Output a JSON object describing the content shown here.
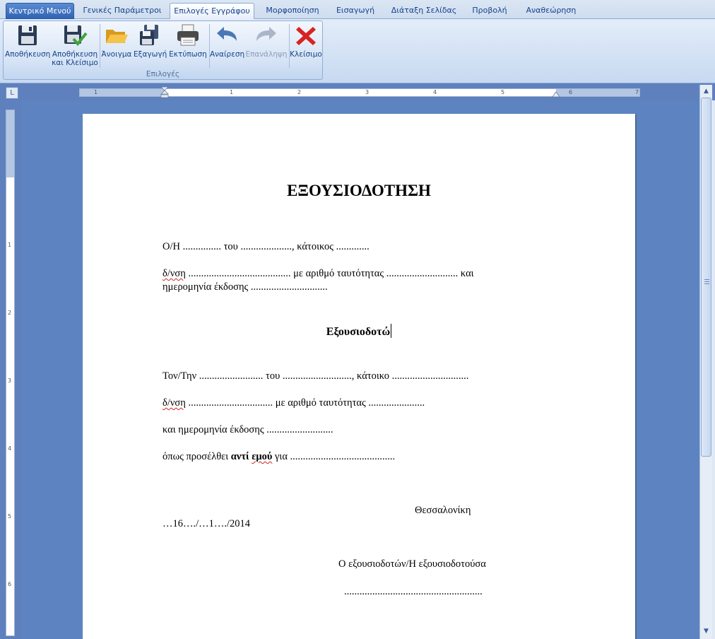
{
  "tabs": [
    {
      "label": "Κεντρικό Μενού",
      "state": "main"
    },
    {
      "label": "Γενικές Παράμετροι",
      "state": "normal"
    },
    {
      "label": "Επιλογές Εγγράφου",
      "state": "active"
    },
    {
      "label": "Μορφοποίηση",
      "state": "normal"
    },
    {
      "label": "Εισαγωγή",
      "state": "normal"
    },
    {
      "label": "Διάταξη Σελίδας",
      "state": "normal"
    },
    {
      "label": "Προβολή",
      "state": "normal"
    },
    {
      "label": "Αναθεώρηση",
      "state": "normal"
    }
  ],
  "ribbon": {
    "group_label": "Επιλογές",
    "buttons": {
      "save": {
        "line1": "Αποθήκευση",
        "line2": "",
        "icon": "save-icon"
      },
      "save_close": {
        "line1": "Αποθήκευση",
        "line2": "και Κλείσιμο",
        "icon": "save-close-icon"
      },
      "open": {
        "line1": "Άνοιγμα",
        "line2": "",
        "icon": "folder-open-icon"
      },
      "export": {
        "line1": "Εξαγωγή",
        "line2": "",
        "icon": "export-icon"
      },
      "print": {
        "line1": "Εκτύπωση",
        "line2": "",
        "icon": "printer-icon"
      },
      "undo": {
        "line1": "Αναίρεση",
        "line2": "",
        "icon": "undo-icon"
      },
      "redo": {
        "line1": "Επανάληψη",
        "line2": "",
        "icon": "redo-icon",
        "disabled": true
      },
      "close": {
        "line1": "Κλείσιμο",
        "line2": "",
        "icon": "close-icon"
      }
    }
  },
  "ruler": {
    "corner_symbol": "L",
    "h_numbers": [
      "1",
      "1",
      "2",
      "3",
      "4",
      "5",
      "6",
      "7"
    ],
    "v_numbers": [
      "1",
      "2",
      "3",
      "4",
      "5",
      "6"
    ]
  },
  "document": {
    "title": "ΕΞΟΥΣΙΟΔΟΤΗΣΗ",
    "p1": "Ο/Η ............... του ...................., κάτοικος .............",
    "p2a_sq": "δ/νση",
    "p2a_rest": " ........................................ με αριθμό ταυτότητας ............................ και",
    "p2b": "ημερομηνία έκδοσης ..............................",
    "heading": "Εξουσιοδοτώ",
    "p3": "Τον/Την ......................... του ..........................., κάτοικο ..............................",
    "p4_sq": "δ/νση",
    "p4_rest": " ................................. με αριθμό ταυτότητας  ......................",
    "p5": "και ημερομηνία έκδοσης ..........................",
    "p6_pre": "όπως προσέλθει ",
    "p6_bold1": "αντί ",
    "p6_bold2": "εμού",
    "p6_post": " για .........................................",
    "city": "Θεσσαλονίκη",
    "date": "…16…./…1…./2014",
    "signatory": "Ο εξουσιοδοτών/Η εξουσιοδοτούσα",
    "signature_line": "......................................................"
  },
  "colors": {
    "accent": "#2f63b4",
    "workspace": "#5d84c0",
    "ribbon_text": "#15428b",
    "close_red": "#d8231f"
  }
}
